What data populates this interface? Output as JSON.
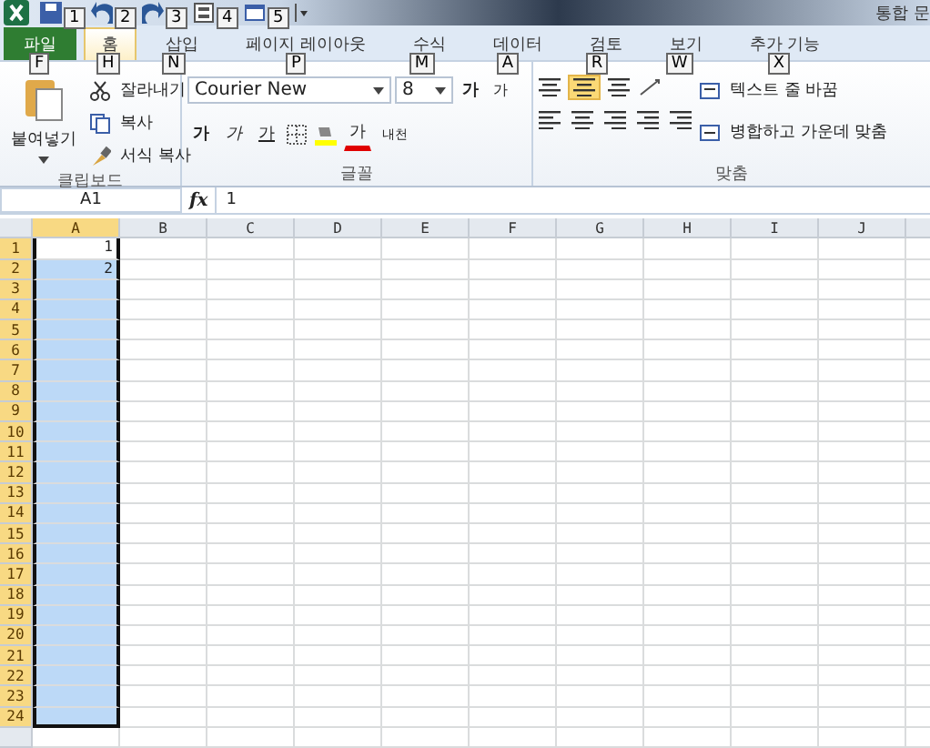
{
  "window": {
    "title": "통합 문"
  },
  "quick_access": [
    {
      "kind": "save",
      "keytip": "1"
    },
    {
      "kind": "undo",
      "keytip": "2"
    },
    {
      "kind": "redo",
      "keytip": "3"
    },
    {
      "kind": "form",
      "keytip": "4"
    },
    {
      "kind": "print",
      "keytip": "5"
    }
  ],
  "tabs": [
    {
      "label": "파일",
      "keytip": "F",
      "kind": "file",
      "selected": false
    },
    {
      "label": "홈",
      "keytip": "H",
      "kind": "tab",
      "selected": true
    },
    {
      "label": "삽입",
      "keytip": "N",
      "kind": "tab",
      "selected": false
    },
    {
      "label": "페이지 레이아웃",
      "keytip": "P",
      "kind": "tab",
      "selected": false
    },
    {
      "label": "수식",
      "keytip": "M",
      "kind": "tab",
      "selected": false
    },
    {
      "label": "데이터",
      "keytip": "A",
      "kind": "tab",
      "selected": false
    },
    {
      "label": "검토",
      "keytip": "R",
      "kind": "tab",
      "selected": false
    },
    {
      "label": "보기",
      "keytip": "W",
      "kind": "tab",
      "selected": false
    },
    {
      "label": "추가 기능",
      "keytip": "X",
      "kind": "tab",
      "selected": false
    }
  ],
  "clipboard": {
    "label": "클립보드",
    "paste": "붙여넣기",
    "cut": "잘라내기",
    "copy": "복사",
    "format_painter": "서식 복사"
  },
  "font": {
    "label": "글꼴",
    "name": "Courier New",
    "size": "8",
    "grow": "가",
    "shrink": "가",
    "bold": "가",
    "italic": "가",
    "underline": "가",
    "font_color": "가",
    "phonetic": "내천"
  },
  "alignment": {
    "label": "맞춤",
    "wrap_text": "텍스트 줄 바꿈",
    "merge_center": "병합하고 가운데 맞춤",
    "middle_align_selected": true
  },
  "formula_bar": {
    "name_box": "A1",
    "fx": "fx",
    "value": "1"
  },
  "columns": [
    {
      "label": "A",
      "selected": true
    },
    {
      "label": "B",
      "selected": false
    },
    {
      "label": "C",
      "selected": false
    },
    {
      "label": "D",
      "selected": false
    },
    {
      "label": "E",
      "selected": false
    },
    {
      "label": "F",
      "selected": false
    },
    {
      "label": "G",
      "selected": false
    },
    {
      "label": "H",
      "selected": false
    },
    {
      "label": "I",
      "selected": false
    },
    {
      "label": "J",
      "selected": false
    }
  ],
  "rows": [
    {
      "label": "1",
      "selected": true,
      "cells": [
        "1"
      ]
    },
    {
      "label": "2",
      "selected": true,
      "cells": [
        "2"
      ]
    },
    {
      "label": "3",
      "selected": true
    },
    {
      "label": "4",
      "selected": true
    },
    {
      "label": "5",
      "selected": true
    },
    {
      "label": "6",
      "selected": true
    },
    {
      "label": "7",
      "selected": true
    },
    {
      "label": "8",
      "selected": true
    },
    {
      "label": "9",
      "selected": true
    },
    {
      "label": "10",
      "selected": true
    },
    {
      "label": "11",
      "selected": true
    },
    {
      "label": "12",
      "selected": true
    },
    {
      "label": "13",
      "selected": true
    },
    {
      "label": "14",
      "selected": true
    },
    {
      "label": "15",
      "selected": true
    },
    {
      "label": "16",
      "selected": true
    },
    {
      "label": "17",
      "selected": true
    },
    {
      "label": "18",
      "selected": true
    },
    {
      "label": "19",
      "selected": true
    },
    {
      "label": "20",
      "selected": true
    },
    {
      "label": "21",
      "selected": true
    },
    {
      "label": "22",
      "selected": true
    },
    {
      "label": "23",
      "selected": true
    },
    {
      "label": "24",
      "selected": true
    }
  ]
}
